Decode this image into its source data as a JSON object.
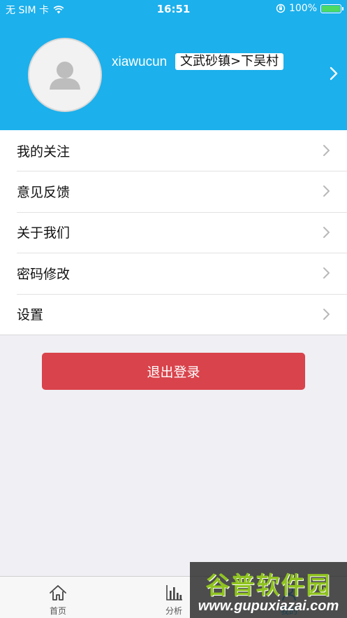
{
  "status_bar": {
    "carrier": "无 SIM 卡",
    "time": "16:51",
    "battery": "100%"
  },
  "profile": {
    "username": "xiawucun",
    "location": "文武砂镇>下吴村"
  },
  "menu": {
    "items": [
      {
        "label": "我的关注"
      },
      {
        "label": "意见反馈"
      },
      {
        "label": "关于我们"
      },
      {
        "label": "密码修改"
      },
      {
        "label": "设置"
      }
    ]
  },
  "logout_label": "退出登录",
  "tabbar": {
    "tabs": [
      {
        "label": "首页",
        "icon": "home-icon"
      },
      {
        "label": "分析",
        "icon": "bar-chart-icon"
      },
      {
        "label": "我的",
        "icon": "user-icon"
      }
    ]
  },
  "watermark": {
    "title": "谷普软件园",
    "url": "www.gupuxiazai.com"
  },
  "colors": {
    "header": "#1cb0ec",
    "logout": "#d9434b",
    "background": "#efeff4"
  }
}
